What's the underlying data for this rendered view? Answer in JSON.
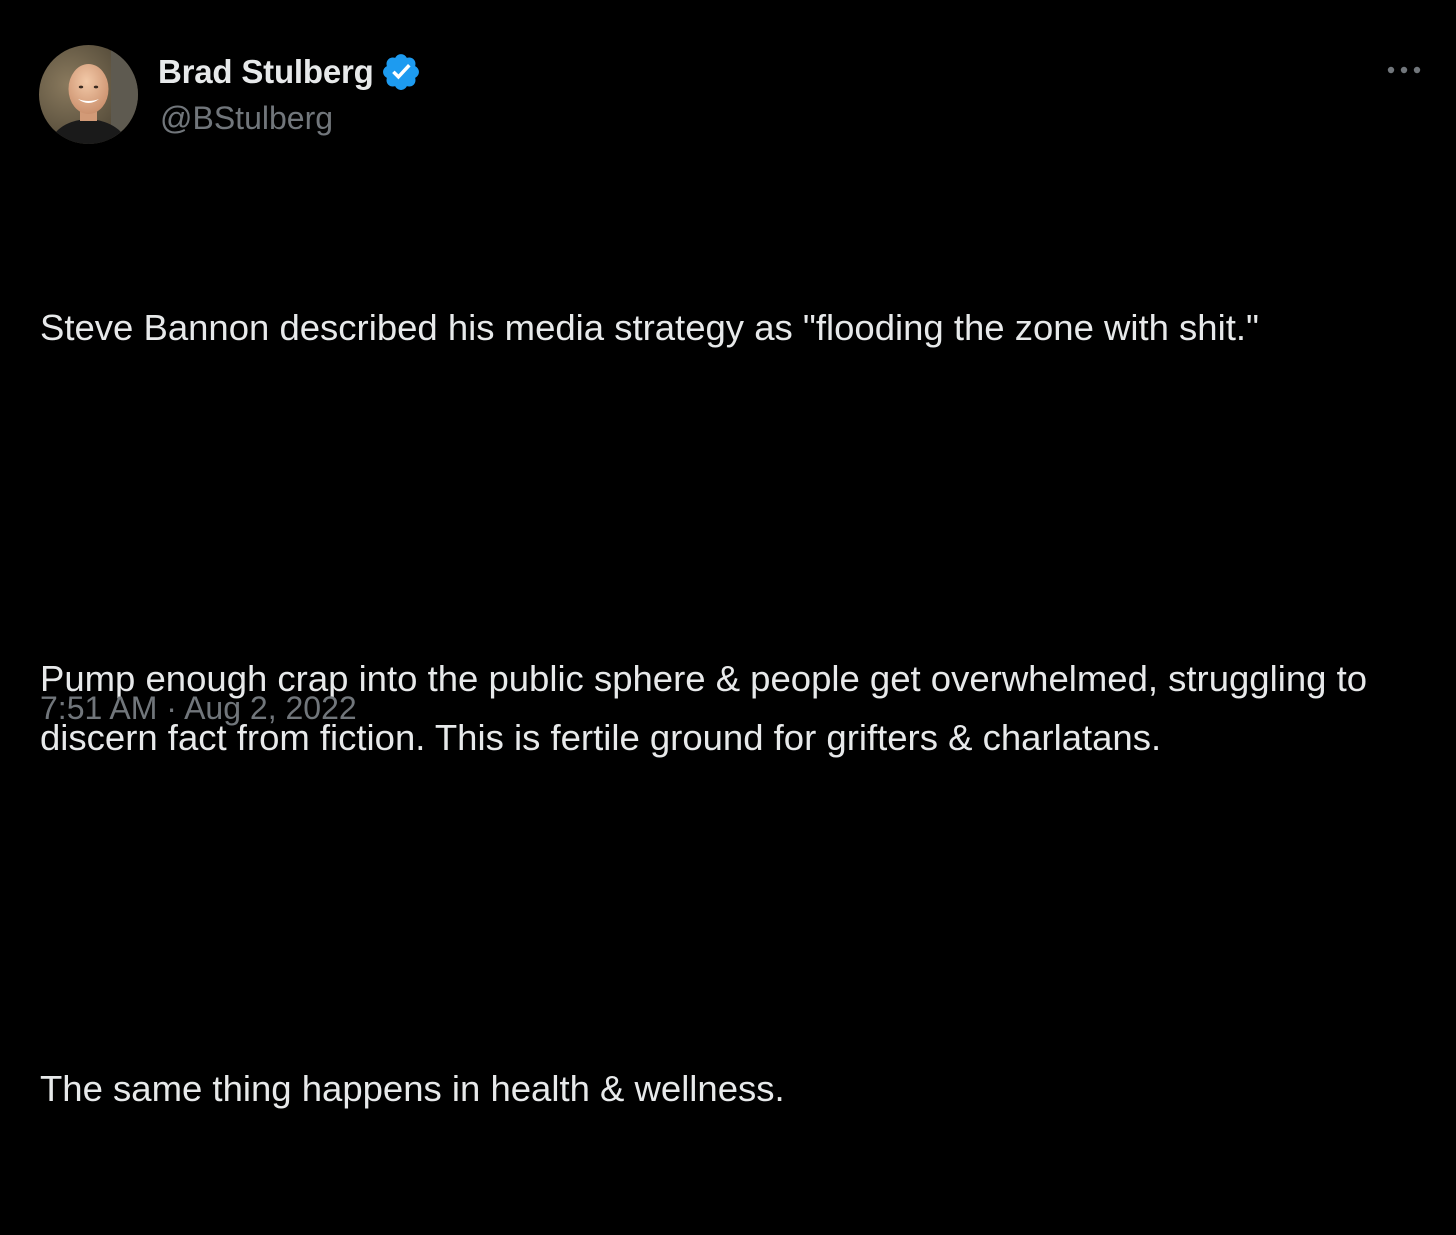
{
  "tweet": {
    "author": {
      "display_name": "Brad Stulberg",
      "handle": "@BStulberg",
      "verified": true,
      "verified_icon": "verified-badge-icon",
      "verified_color": "#1d9bf0"
    },
    "more_icon": "more-horizontal-icon",
    "paragraphs": [
      "Steve Bannon described his media strategy as \"flooding the zone with shit.\"",
      "Pump enough crap into the public sphere & people get overwhelmed, struggling to discern fact from fiction. This is fertile ground for grifters & charlatans.",
      "The same thing happens in health & wellness."
    ],
    "time": "7:51 AM",
    "separator": " · ",
    "date": "Aug 2, 2022"
  },
  "colors": {
    "background": "#000000",
    "primary_text": "#e7e9ea",
    "secondary_text": "#71767b",
    "accent": "#1d9bf0"
  }
}
